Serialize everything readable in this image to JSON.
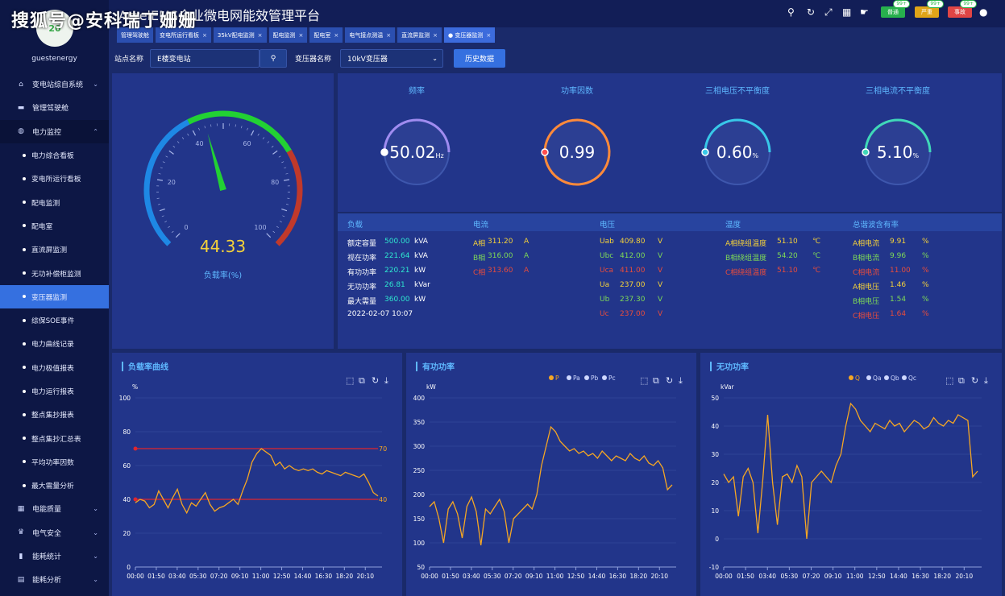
{
  "watermark": "搜狐号@安科瑞丁姗姗",
  "app": {
    "title": "AcrelEMS企业微电网能效管理平台",
    "user": "guestenergy",
    "logo": "20"
  },
  "sidebar": {
    "items": [
      {
        "label": "变电站综自系统",
        "icon": "home-icon",
        "glyph": "⌂",
        "type": "top",
        "chevron": "⌄"
      },
      {
        "label": "管理驾驶舱",
        "icon": "monitor-icon",
        "glyph": "▬",
        "type": "top"
      },
      {
        "label": "电力监控",
        "icon": "globe-icon",
        "glyph": "◍",
        "type": "top",
        "chevron": "⌃",
        "open": true
      },
      {
        "label": "电力综合看板",
        "type": "sub"
      },
      {
        "label": "变电所运行看板",
        "type": "sub"
      },
      {
        "label": "配电监测",
        "type": "sub"
      },
      {
        "label": "配电室",
        "type": "sub"
      },
      {
        "label": "直流屏监测",
        "type": "sub"
      },
      {
        "label": "无功补偿柜监测",
        "type": "sub"
      },
      {
        "label": "变压器监测",
        "type": "sub",
        "active": true
      },
      {
        "label": "综保SOE事件",
        "type": "sub"
      },
      {
        "label": "电力曲线记录",
        "type": "sub"
      },
      {
        "label": "电力极值报表",
        "type": "sub"
      },
      {
        "label": "电力运行报表",
        "type": "sub"
      },
      {
        "label": "整点集抄报表",
        "type": "sub"
      },
      {
        "label": "整点集抄汇总表",
        "type": "sub"
      },
      {
        "label": "平均功率因数",
        "type": "sub"
      },
      {
        "label": "最大需量分析",
        "type": "sub"
      },
      {
        "label": "电能质量",
        "icon": "quality-icon",
        "glyph": "▦",
        "type": "top",
        "chevron": "⌄"
      },
      {
        "label": "电气安全",
        "icon": "alarm-icon",
        "glyph": "♛",
        "type": "top",
        "chevron": "⌄"
      },
      {
        "label": "能耗统计",
        "icon": "bar-chart-icon",
        "glyph": "▮",
        "type": "top",
        "chevron": "⌄"
      },
      {
        "label": "能耗分析",
        "icon": "analysis-icon",
        "glyph": "▤",
        "type": "top",
        "chevron": "⌄"
      }
    ]
  },
  "header": {
    "badges": [
      {
        "label": "普通",
        "count": "99+",
        "color": "#27b04d"
      },
      {
        "label": "严重",
        "count": "99+",
        "color": "#e0a418"
      },
      {
        "label": "事故",
        "count": "99+",
        "color": "#e04545"
      }
    ]
  },
  "tabs": [
    {
      "label": "管理驾驶舱",
      "closable": false
    },
    {
      "label": "变电所运行看板",
      "closable": true
    },
    {
      "label": "35kV配电监测",
      "closable": true
    },
    {
      "label": "配电监测",
      "closable": true
    },
    {
      "label": "配电室",
      "closable": true
    },
    {
      "label": "电气接点测温",
      "closable": true
    },
    {
      "label": "直流屏监测",
      "closable": true
    },
    {
      "label": "● 变压器监测",
      "closable": true,
      "active": true
    }
  ],
  "filters": {
    "station_label": "站点名称",
    "station_value": "E楼变电站",
    "transformer_label": "变压器名称",
    "transformer_value": "10kV变压器",
    "history_button": "历史数据"
  },
  "gauge": {
    "value": "44.33",
    "label": "负载率(%)",
    "numeric": 44.33,
    "ticks": [
      "0",
      "20",
      "40",
      "60",
      "80",
      "100"
    ]
  },
  "rings": [
    {
      "title": "频率",
      "value": "50.02",
      "unit": "Hz",
      "fraction": 0.5,
      "color": "#a08cf0",
      "dot": "#ffffff"
    },
    {
      "title": "功率因数",
      "value": "0.99",
      "unit": "",
      "fraction": 0.99,
      "color": "#ff8a3a",
      "dot": "#ff4d4d"
    },
    {
      "title": "三相电压不平衡度",
      "value": "0.60",
      "unit": "%",
      "fraction": 0.5,
      "color": "#38c8e8",
      "dot": "#38c8e8"
    },
    {
      "title": "三相电流不平衡度",
      "value": "5.10",
      "unit": "%",
      "fraction": 0.5,
      "color": "#40d8b8",
      "dot": "#40d8b8"
    }
  ],
  "table": {
    "headers": [
      "负载",
      "电流",
      "电压",
      "温度",
      "总谐波含有率"
    ],
    "load": [
      {
        "k": "额定容量",
        "v": "500.00",
        "u": "kVA"
      },
      {
        "k": "视在功率",
        "v": "221.64",
        "u": "kVA"
      },
      {
        "k": "有功功率",
        "v": "220.21",
        "u": "kW"
      },
      {
        "k": "无功功率",
        "v": "26.81",
        "u": "kVar"
      },
      {
        "k": "最大需量",
        "v": "360.00",
        "u": "kW"
      }
    ],
    "timestamp": "2022-02-07 10:07",
    "current": [
      {
        "k": "A相",
        "v": "311.20",
        "u": "A",
        "c": "#f4d13a"
      },
      {
        "k": "B相",
        "v": "316.00",
        "u": "A",
        "c": "#7ed957"
      },
      {
        "k": "C相",
        "v": "313.60",
        "u": "A",
        "c": "#e74c3c"
      }
    ],
    "voltage": [
      {
        "k": "Uab",
        "v": "409.80",
        "u": "V",
        "c": "#f4d13a"
      },
      {
        "k": "Ubc",
        "v": "412.00",
        "u": "V",
        "c": "#7ed957"
      },
      {
        "k": "Uca",
        "v": "411.00",
        "u": "V",
        "c": "#e74c3c"
      },
      {
        "k": "Ua",
        "v": "237.00",
        "u": "V",
        "c": "#f4d13a"
      },
      {
        "k": "Ub",
        "v": "237.30",
        "u": "V",
        "c": "#7ed957"
      },
      {
        "k": "Uc",
        "v": "237.00",
        "u": "V",
        "c": "#e74c3c"
      }
    ],
    "temperature": [
      {
        "k": "A相绕组温度",
        "v": "51.10",
        "u": "℃",
        "c": "#f4d13a"
      },
      {
        "k": "B相绕组温度",
        "v": "54.20",
        "u": "℃",
        "c": "#7ed957"
      },
      {
        "k": "C相绕组温度",
        "v": "51.10",
        "u": "℃",
        "c": "#e74c3c"
      }
    ],
    "thd": [
      {
        "k": "A相电流",
        "v": "9.91",
        "u": "%",
        "c": "#f4d13a"
      },
      {
        "k": "B相电流",
        "v": "9.96",
        "u": "%",
        "c": "#7ed957"
      },
      {
        "k": "C相电流",
        "v": "11.00",
        "u": "%",
        "c": "#e74c3c"
      },
      {
        "k": "A相电压",
        "v": "1.46",
        "u": "%",
        "c": "#f4d13a"
      },
      {
        "k": "B相电压",
        "v": "1.54",
        "u": "%",
        "c": "#7ed957"
      },
      {
        "k": "C相电压",
        "v": "1.64",
        "u": "%",
        "c": "#e74c3c"
      }
    ]
  },
  "chart_data": [
    {
      "type": "line",
      "title": "负载率曲线",
      "ylabel": "%",
      "ylim": [
        0,
        100
      ],
      "yticks": [
        0,
        20,
        40,
        60,
        80,
        100
      ],
      "x": [
        "00:00",
        "01:50",
        "03:40",
        "05:30",
        "07:20",
        "09:10",
        "11:00",
        "12:50",
        "14:40",
        "16:30",
        "18:20",
        "20:10"
      ],
      "legend": [],
      "markLines": [
        {
          "value": 70,
          "label": "70"
        },
        {
          "value": 40,
          "label": "40"
        }
      ],
      "series": [
        {
          "name": "负载率",
          "color": "#f5a623",
          "values": [
            38,
            40,
            39,
            35,
            37,
            45,
            40,
            35,
            41,
            46,
            37,
            32,
            38,
            36,
            40,
            44,
            37,
            33,
            35,
            36,
            38,
            40,
            37,
            45,
            52,
            62,
            67,
            70,
            68,
            66,
            60,
            62,
            58,
            60,
            58,
            57,
            58,
            57,
            58,
            56,
            55,
            57,
            56,
            55,
            54,
            56,
            55,
            54,
            53,
            55,
            50,
            44,
            42
          ]
        }
      ]
    },
    {
      "type": "line",
      "title": "有功功率",
      "ylabel": "kW",
      "ylim": [
        50,
        400
      ],
      "yticks": [
        50,
        100,
        150,
        200,
        250,
        300,
        350,
        400
      ],
      "x": [
        "00:00",
        "01:50",
        "03:40",
        "05:30",
        "07:20",
        "09:10",
        "11:00",
        "12:50",
        "14:40",
        "16:30",
        "18:20",
        "20:10"
      ],
      "legend": [
        {
          "name": "P",
          "color": "#f5a623"
        },
        {
          "name": "Pa",
          "color": "#cfd8ff"
        },
        {
          "name": "Pb",
          "color": "#cfd8ff"
        },
        {
          "name": "Pc",
          "color": "#cfd8ff"
        }
      ],
      "markLines": [],
      "series": [
        {
          "name": "P",
          "color": "#f5a623",
          "values": [
            175,
            185,
            150,
            100,
            170,
            185,
            160,
            110,
            175,
            195,
            165,
            95,
            170,
            160,
            175,
            190,
            165,
            100,
            150,
            160,
            170,
            180,
            170,
            200,
            260,
            300,
            340,
            330,
            310,
            300,
            290,
            295,
            285,
            290,
            280,
            285,
            275,
            290,
            280,
            270,
            280,
            275,
            270,
            285,
            275,
            270,
            280,
            265,
            260,
            270,
            255,
            210,
            220
          ]
        }
      ]
    },
    {
      "type": "line",
      "title": "无功功率",
      "ylabel": "kVar",
      "ylim": [
        -10,
        50
      ],
      "yticks": [
        -10,
        0,
        10,
        20,
        30,
        40,
        50
      ],
      "x": [
        "00:00",
        "01:50",
        "03:40",
        "05:30",
        "07:20",
        "09:10",
        "11:00",
        "12:50",
        "14:40",
        "16:30",
        "18:20",
        "20:10"
      ],
      "legend": [
        {
          "name": "Q",
          "color": "#f5a623"
        },
        {
          "name": "Qa",
          "color": "#cfd8ff"
        },
        {
          "name": "Qb",
          "color": "#cfd8ff"
        },
        {
          "name": "Qc",
          "color": "#cfd8ff"
        }
      ],
      "markLines": [],
      "series": [
        {
          "name": "Q",
          "color": "#f5a623",
          "values": [
            23,
            20,
            22,
            8,
            22,
            25,
            20,
            2,
            21,
            44,
            20,
            5,
            22,
            23,
            20,
            26,
            22,
            0,
            20,
            22,
            24,
            22,
            20,
            26,
            30,
            40,
            48,
            46,
            42,
            40,
            38,
            41,
            40,
            39,
            42,
            40,
            41,
            38,
            40,
            42,
            41,
            39,
            40,
            43,
            41,
            40,
            42,
            41,
            44,
            43,
            42,
            22,
            24
          ]
        }
      ]
    }
  ]
}
